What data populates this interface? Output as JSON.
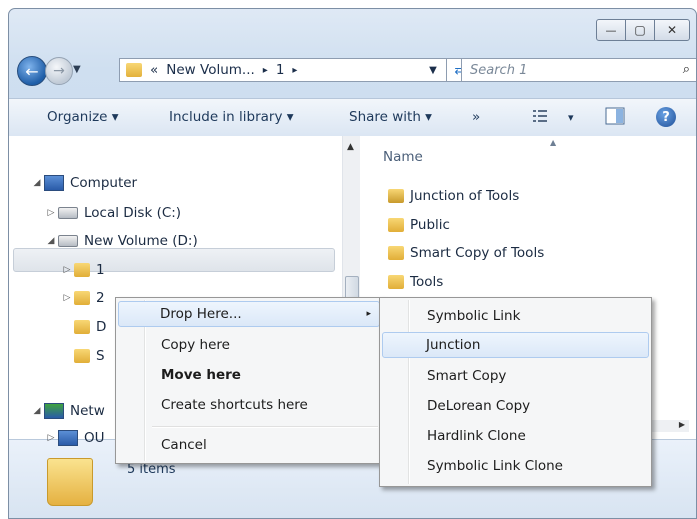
{
  "window": {
    "controls": {
      "minimize": "—",
      "maximize": "▢",
      "close": "✕"
    }
  },
  "address_bar": {
    "overflow": "«",
    "crumbs": [
      "New Volum...",
      "1"
    ],
    "separator": "▸"
  },
  "search": {
    "placeholder": "Search 1",
    "icon": "⌕"
  },
  "toolbar": {
    "organize": "Organize ▾",
    "include": "Include in library ▾",
    "share": "Share with ▾",
    "more": "»",
    "views_arrow": "▾",
    "help": "?"
  },
  "nav_tree": {
    "items": [
      {
        "label": "Computer",
        "icon": "computer-icon"
      },
      {
        "label": "Local Disk (C:)",
        "icon": "disk-icon"
      },
      {
        "label": "New Volume (D:)",
        "icon": "disk-icon"
      },
      {
        "label": "1",
        "icon": "folder-icon"
      },
      {
        "label": "2",
        "icon": "folder-icon"
      },
      {
        "label": "D",
        "icon": "folder-icon"
      },
      {
        "label": "S",
        "icon": "folder-icon"
      },
      {
        "label": "Netw",
        "icon": "network-icon"
      },
      {
        "label": "OU",
        "icon": "computer-icon"
      }
    ]
  },
  "content": {
    "column_name": "Name",
    "files": [
      {
        "label": "Junction of Tools",
        "icon": "junction-folder-icon"
      },
      {
        "label": "Public",
        "icon": "folder-icon"
      },
      {
        "label": "Smart Copy of Tools",
        "icon": "folder-icon"
      },
      {
        "label": "Tools",
        "icon": "folder-icon"
      }
    ]
  },
  "details": {
    "count": "5 items"
  },
  "context_menu": {
    "items": [
      "Drop Here...",
      "Copy here",
      "Move here",
      "Create shortcuts here",
      "Cancel"
    ],
    "submenu_arrow": "▸"
  },
  "submenu": {
    "items": [
      "Symbolic Link",
      "Junction",
      "Smart Copy",
      "DeLorean Copy",
      "Hardlink Clone",
      "Symbolic Link Clone"
    ]
  }
}
